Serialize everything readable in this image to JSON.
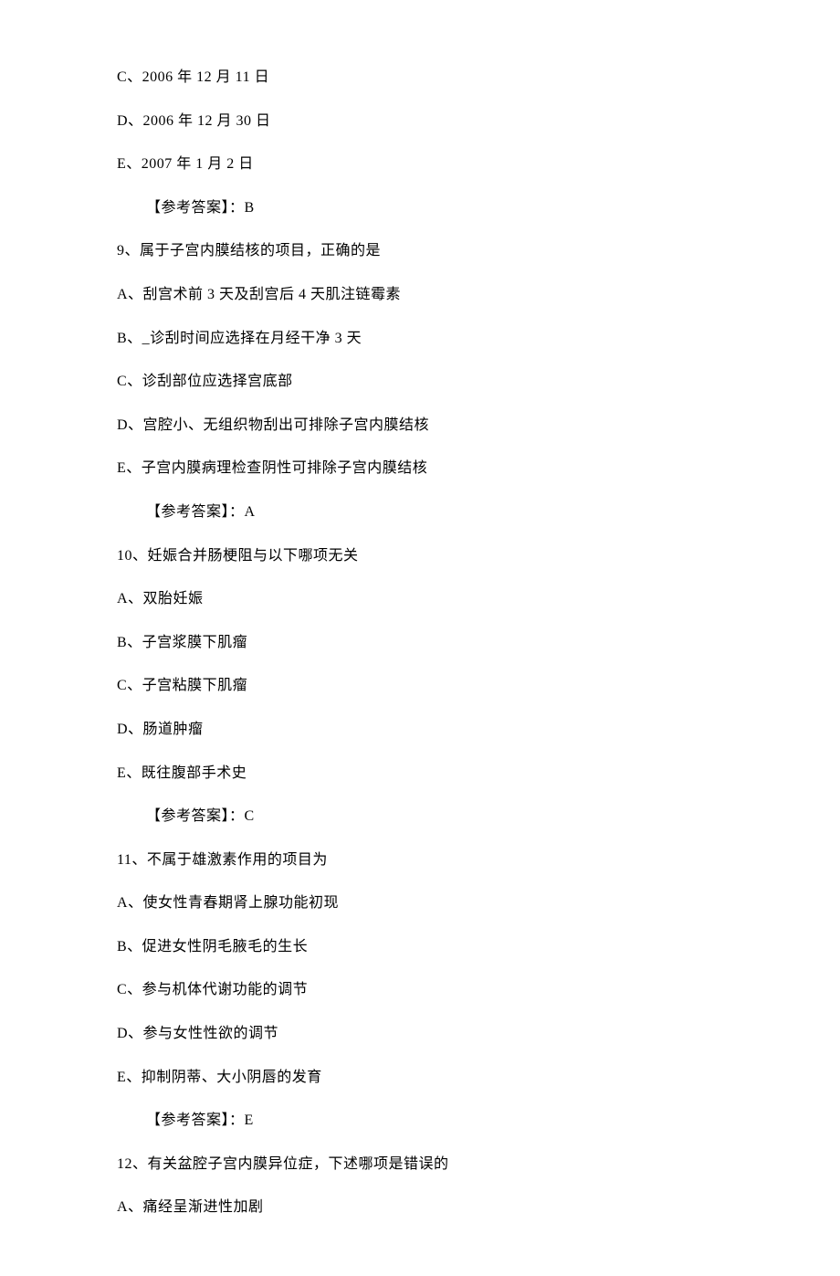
{
  "q8": {
    "optC": "C、2006 年 12 月 11 日",
    "optD": "D、2006 年 12 月 30 日",
    "optE": "E、2007 年 1 月 2 日",
    "answer": "【参考答案】：B"
  },
  "q9": {
    "stem": "9、属于子宫内膜结核的项目，正确的是",
    "optA": "A、刮宫术前 3 天及刮宫后 4 天肌注链霉素",
    "optB": "B、_诊刮时间应选择在月经干净 3 天",
    "optC": "C、诊刮部位应选择宫底部",
    "optD": "D、宫腔小、无组织物刮出可排除子宫内膜结核",
    "optE": "E、子宫内膜病理检查阴性可排除子宫内膜结核",
    "answer": "【参考答案】：A"
  },
  "q10": {
    "stem": "10、妊娠合并肠梗阻与以下哪项无关",
    "optA": "A、双胎妊娠",
    "optB": "B、子宫浆膜下肌瘤",
    "optC": "C、子宫粘膜下肌瘤",
    "optD": "D、肠道肿瘤",
    "optE": "E、既往腹部手术史",
    "answer": "【参考答案】：C"
  },
  "q11": {
    "stem": "11、不属于雄激素作用的项目为",
    "optA": "A、使女性青春期肾上腺功能初现",
    "optB": "B、促进女性阴毛腋毛的生长",
    "optC": "C、参与机体代谢功能的调节",
    "optD": "D、参与女性性欲的调节",
    "optE": "E、抑制阴蒂、大小阴唇的发育",
    "answer": "【参考答案】：E"
  },
  "q12": {
    "stem": "12、有关盆腔子宫内膜异位症，下述哪项是错误的",
    "optA": "A、痛经呈渐进性加剧"
  }
}
